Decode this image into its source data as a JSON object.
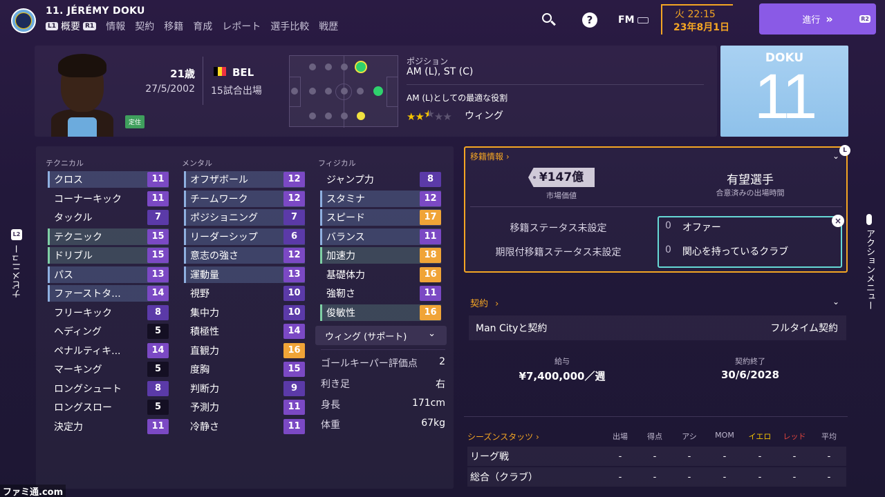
{
  "header": {
    "player_title": "11. JÉRÉMY DOKU",
    "l1_tag": "L1",
    "r1_tag": "R1",
    "tabs": [
      "概要",
      "情報",
      "契約",
      "移籍",
      "育成",
      "レポート",
      "選手比較",
      "戦歴"
    ],
    "fm_label": "FM",
    "time": "火 22:15",
    "date": "23年8月1日",
    "continue_label": "進行",
    "continue_icon": "»",
    "r2_tag": "R2",
    "help_label": "?"
  },
  "profile": {
    "age": "21歳",
    "dob": "27/5/2002",
    "nation": "BEL",
    "flag_colors": [
      "#000000",
      "#fdda24",
      "#ef3340"
    ],
    "appearances": "15試合出場",
    "status_badge": "定住",
    "position_label": "ポジション",
    "position_value": "AM (L), ST (C)",
    "role_label": "AM (L)としての最適な役割",
    "role_stars": "2.5 of 5",
    "role_value": "ウィング",
    "kit_name": "DOKU",
    "kit_number": "11"
  },
  "attributes": {
    "technical_label": "テクニカル",
    "mental_label": "メンタル",
    "physical_label": "フィジカル",
    "technical": [
      {
        "name": "クロス",
        "value": "11"
      },
      {
        "name": "コーナーキック",
        "value": "11"
      },
      {
        "name": "タックル",
        "value": "7"
      },
      {
        "name": "テクニック",
        "value": "15"
      },
      {
        "name": "ドリブル",
        "value": "15"
      },
      {
        "name": "パス",
        "value": "13"
      },
      {
        "name": "ファーストタ...",
        "value": "14"
      },
      {
        "name": "フリーキック",
        "value": "8"
      },
      {
        "name": "ヘディング",
        "value": "5"
      },
      {
        "name": "ペナルティキ...",
        "value": "14"
      },
      {
        "name": "マーキング",
        "value": "5"
      },
      {
        "name": "ロングシュート",
        "value": "8"
      },
      {
        "name": "ロングスロー",
        "value": "5"
      },
      {
        "name": "決定力",
        "value": "11"
      }
    ],
    "mental": [
      {
        "name": "オフザボール",
        "value": "12"
      },
      {
        "name": "チームワーク",
        "value": "12"
      },
      {
        "name": "ポジショニング",
        "value": "7"
      },
      {
        "name": "リーダーシップ",
        "value": "6"
      },
      {
        "name": "意志の強さ",
        "value": "12"
      },
      {
        "name": "運動量",
        "value": "13"
      },
      {
        "name": "視野",
        "value": "10"
      },
      {
        "name": "集中力",
        "value": "10"
      },
      {
        "name": "積極性",
        "value": "14"
      },
      {
        "name": "直観力",
        "value": "16"
      },
      {
        "name": "度胸",
        "value": "15"
      },
      {
        "name": "判断力",
        "value": "9"
      },
      {
        "name": "予測力",
        "value": "11"
      },
      {
        "name": "冷静さ",
        "value": "11"
      }
    ],
    "physical": [
      {
        "name": "ジャンプ力",
        "value": "8"
      },
      {
        "name": "スタミナ",
        "value": "12"
      },
      {
        "name": "スピード",
        "value": "17"
      },
      {
        "name": "バランス",
        "value": "11"
      },
      {
        "name": "加速力",
        "value": "18"
      },
      {
        "name": "基礎体力",
        "value": "16"
      },
      {
        "name": "強靭さ",
        "value": "11"
      },
      {
        "name": "俊敏性",
        "value": "16"
      }
    ],
    "role_select": "ウィング (サポート)",
    "info": [
      {
        "label": "ゴールキーパー評価点",
        "value": "2"
      },
      {
        "label": "利き足",
        "value": "右"
      },
      {
        "label": "身長",
        "value": "171cm"
      },
      {
        "label": "体重",
        "value": "67kg"
      }
    ]
  },
  "transfer": {
    "title": "移籍情報",
    "l_tag": "L",
    "market_value": "¥147億",
    "market_value_label": "市場価値",
    "prospect": "有望選手",
    "prospect_sub": "合意済みの出場時間",
    "status": "移籍ステータス未設定",
    "loan_status": "期限付移籍ステータス未設定",
    "offers_count": "0",
    "offers_label": "オファー",
    "interested_count": "0",
    "interested_label": "関心を持っているクラブ"
  },
  "contract": {
    "title": "契約",
    "club_contract": "Man Cityと契約",
    "type": "フルタイム契約",
    "wage_label": "給与",
    "wage": "¥7,400,000／週",
    "end_label": "契約終了",
    "end_date": "30/6/2028"
  },
  "season_stats": {
    "title": "シーズンスタッツ",
    "headers": [
      "出場",
      "得点",
      "アシ",
      "MOM",
      "イエロ",
      "レッド",
      "平均"
    ],
    "header_colors": [
      "#bdb6cc",
      "#bdb6cc",
      "#bdb6cc",
      "#bdb6cc",
      "#f5c400",
      "#e0443c",
      "#bdb6cc"
    ],
    "rows": [
      {
        "label": "リーグ戦",
        "values": [
          "-",
          "-",
          "-",
          "-",
          "-",
          "-",
          "-"
        ]
      },
      {
        "label": "総合（クラブ）",
        "values": [
          "-",
          "-",
          "-",
          "-",
          "-",
          "-",
          "-"
        ]
      }
    ]
  },
  "side": {
    "left_label": "ナビメニュー",
    "left_tag": "L2",
    "right_label": "アクションメニュー"
  },
  "watermark": "ファミ通.com"
}
